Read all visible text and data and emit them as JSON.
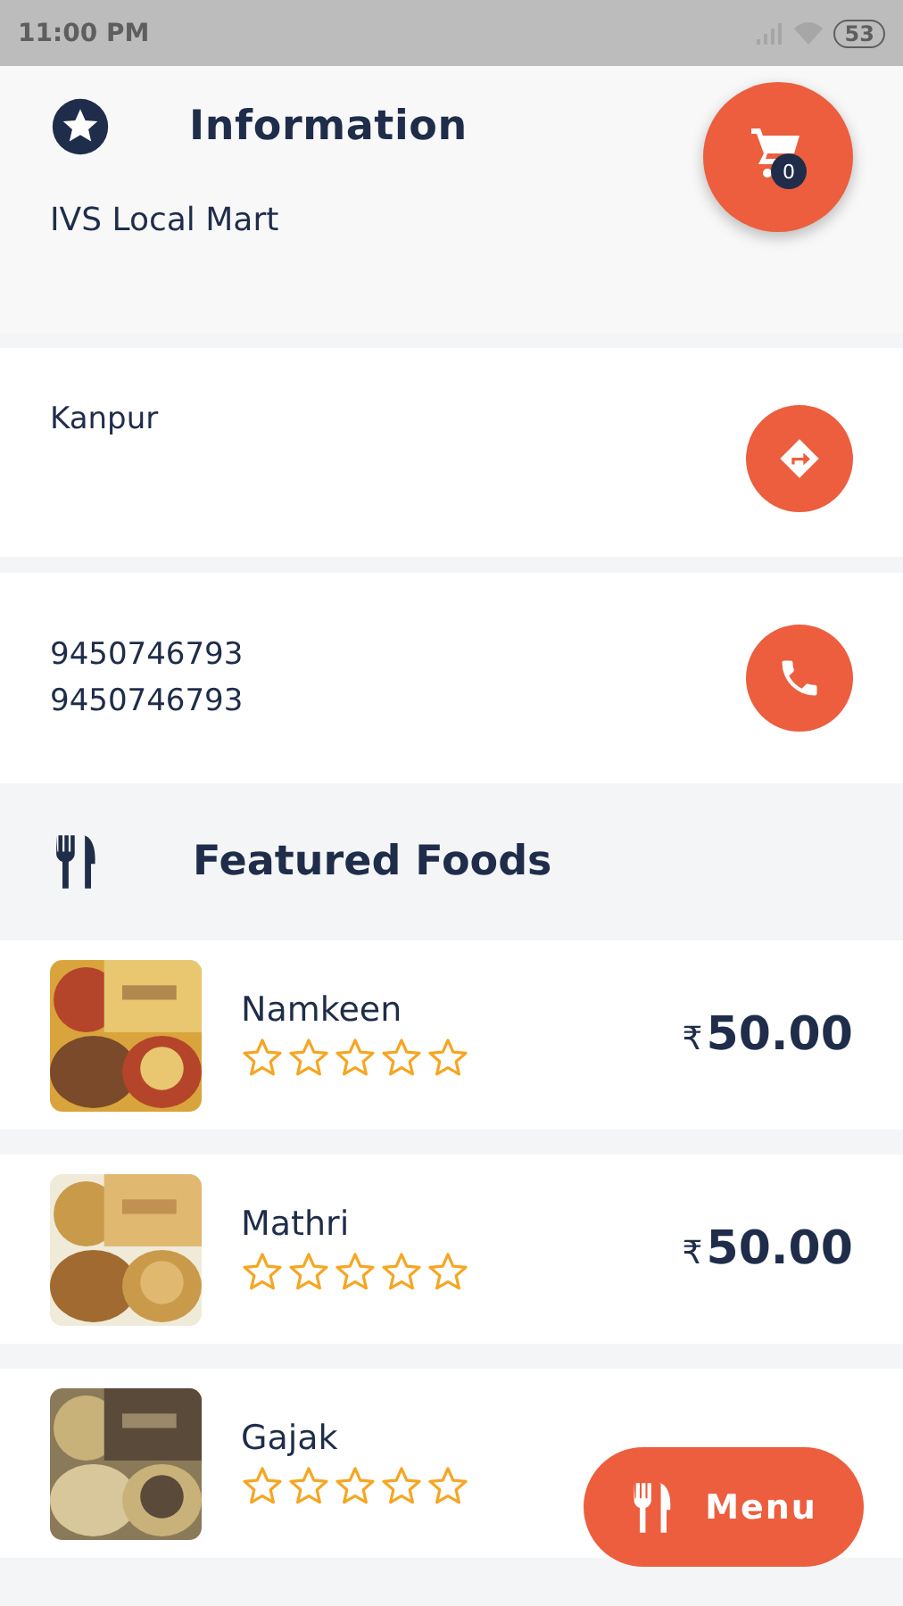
{
  "status_bar": {
    "time": "11:00 PM",
    "battery": "53"
  },
  "information": {
    "title": "Information",
    "store_name": "IVS Local Mart",
    "city": "Kanpur",
    "phones": [
      "9450746793",
      "9450746793"
    ]
  },
  "cart": {
    "count": "0"
  },
  "featured": {
    "title": "Featured Foods",
    "items": [
      {
        "name": "Namkeen",
        "stars": 0,
        "currency": "₹",
        "price": "50.00",
        "kind": "picture"
      },
      {
        "name": "Mathri",
        "stars": 0,
        "currency": "₹",
        "price": "50.00",
        "kind": "picture"
      },
      {
        "name": "Gajak",
        "stars": 0,
        "kind": "picture"
      }
    ]
  },
  "menu_button": {
    "label": "Menu"
  }
}
